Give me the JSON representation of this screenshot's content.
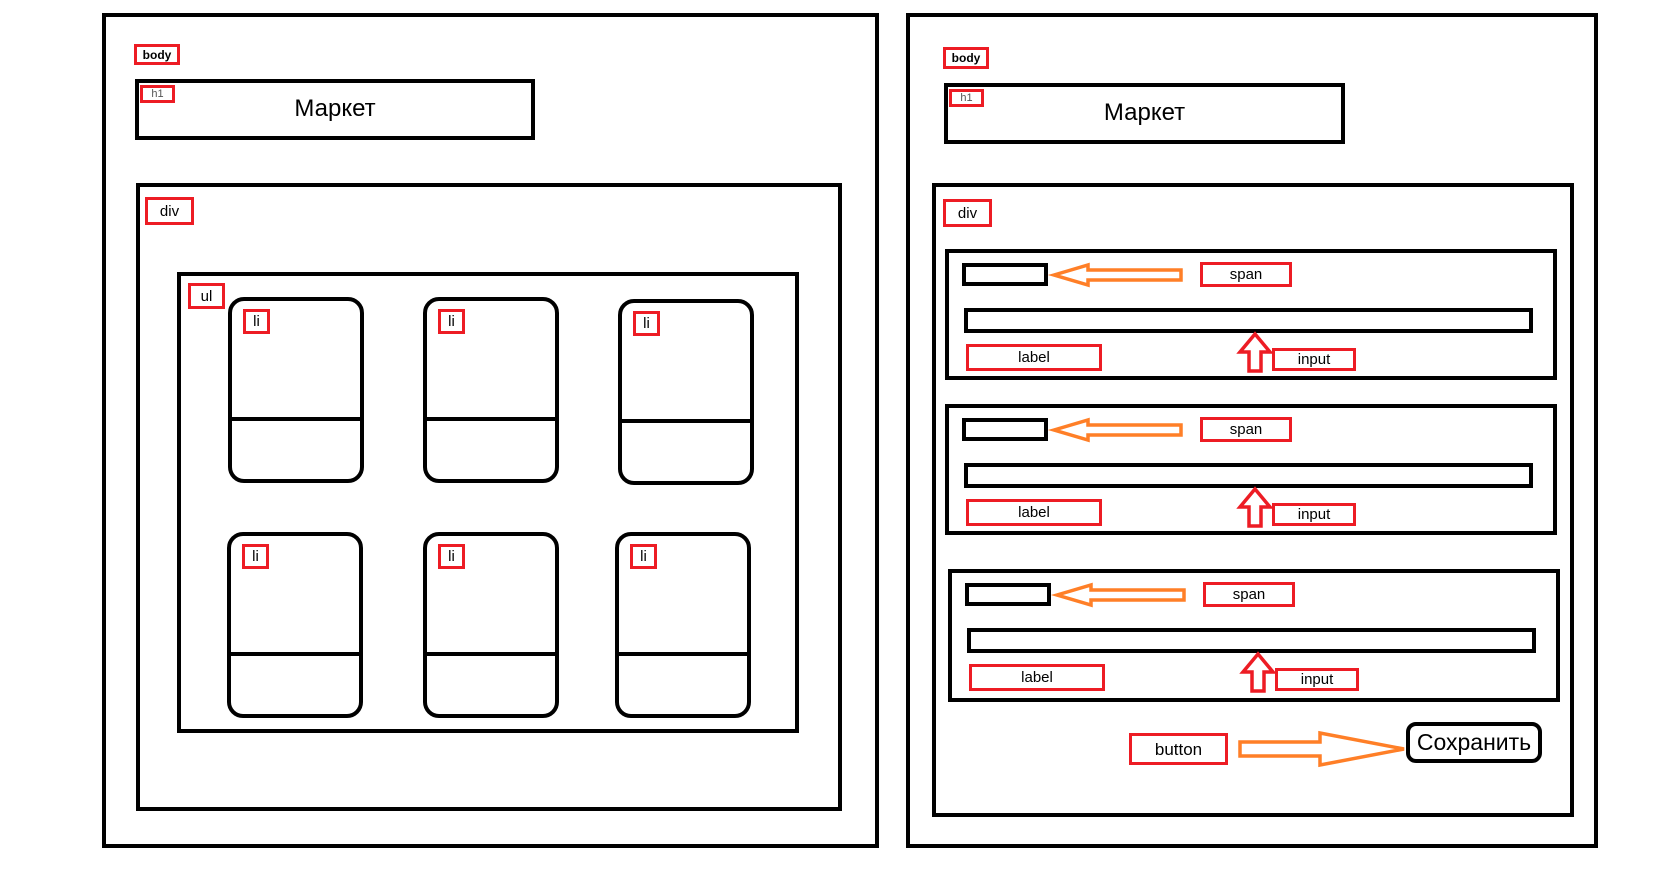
{
  "left_diagram": {
    "body_tag": "body",
    "h1_tag": "h1",
    "title": "Маркет",
    "div_tag": "div",
    "ul_tag": "ul",
    "li_items": [
      "li",
      "li",
      "li",
      "li",
      "li",
      "li"
    ]
  },
  "right_diagram": {
    "body_tag": "body",
    "h1_tag": "h1",
    "title": "Маркет",
    "div_tag": "div",
    "field_groups": [
      {
        "span_tag": "span",
        "label_tag": "label",
        "input_tag": "input"
      },
      {
        "span_tag": "span",
        "label_tag": "label",
        "input_tag": "input"
      },
      {
        "span_tag": "span",
        "label_tag": "label",
        "input_tag": "input"
      }
    ],
    "button_tag": "button",
    "button_label": "Сохранить"
  },
  "colors": {
    "tag_border": "#ed1c24",
    "orange_arrow": "#ff7f27",
    "red_arrow": "#ed1c24",
    "outline": "#000000"
  }
}
